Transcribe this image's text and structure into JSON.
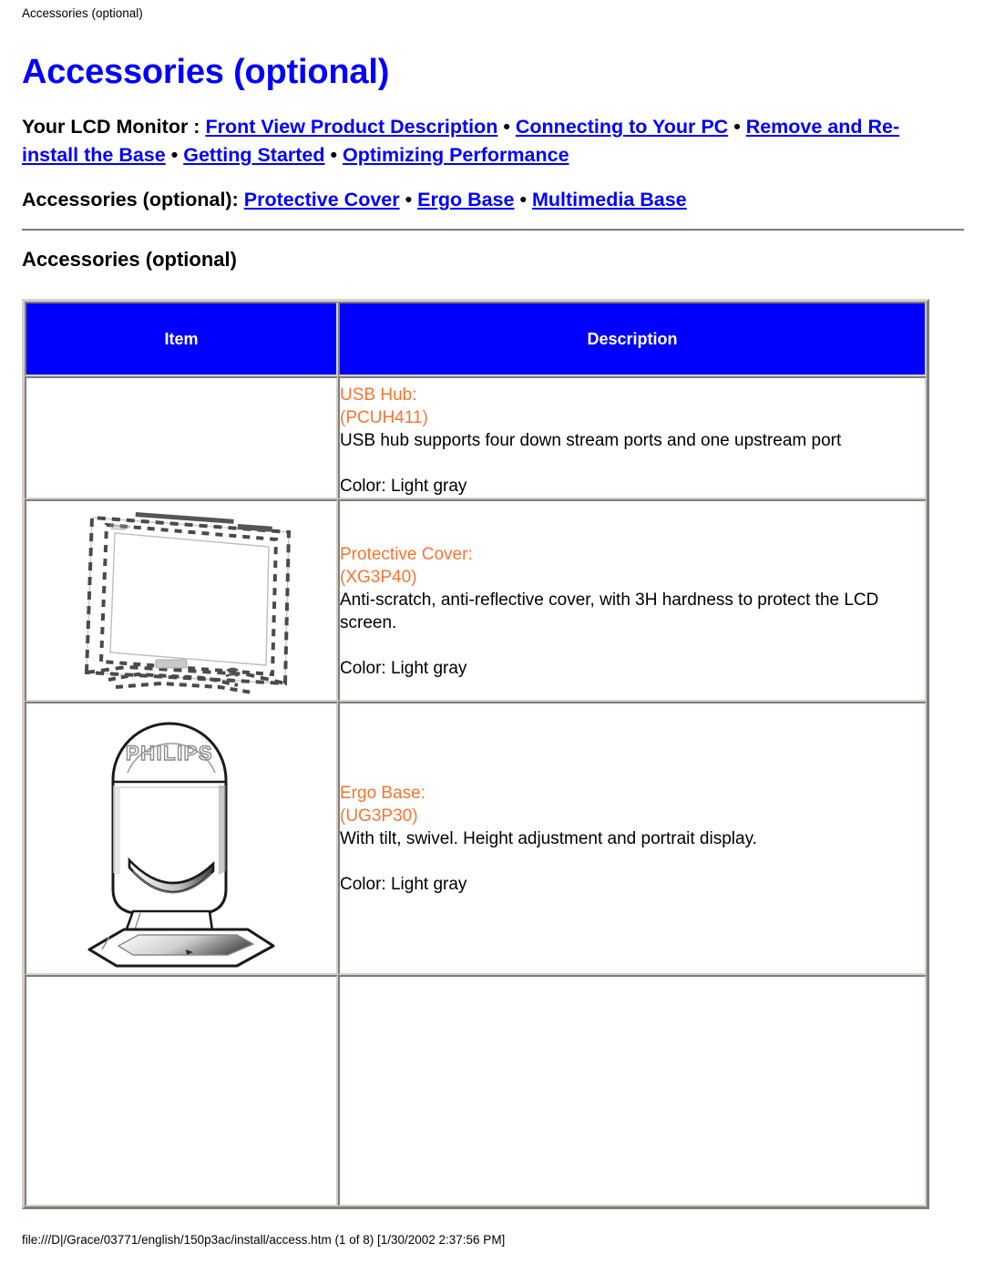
{
  "page_header": "Accessories (optional)",
  "title": "Accessories (optional)",
  "nav": {
    "line1_lead": "Your LCD Monitor",
    "line1_colon": " : ",
    "line1_links": [
      "Front View Product Description",
      "Connecting to Your PC",
      "Remove and Re-install the Base",
      "Getting Started",
      "Optimizing Performance"
    ],
    "line2_lead": "Accessories (optional):",
    "line2_links": [
      "Protective Cover",
      "Ergo Base",
      "Multimedia Base"
    ],
    "separator": "•"
  },
  "section_title": "Accessories (optional)",
  "table": {
    "headers": [
      "Item",
      "Description"
    ],
    "rows": [
      {
        "item_art": "none",
        "name": "USB Hub:",
        "code": "(PCUH411)",
        "description": "USB hub supports four down stream ports and one upstream port",
        "color": "Color: Light gray"
      },
      {
        "item_art": "lcd-monitor-dashed-outline",
        "name": "Protective Cover:",
        "code": "(XG3P40)",
        "description": "Anti-scratch, anti-reflective cover, with 3H hardness to protect the LCD screen.",
        "color": "Color: Light gray"
      },
      {
        "item_art": "philips-ergo-base-stand",
        "name": "Ergo Base:",
        "code": "(UG3P30)",
        "description": "With tilt, swivel. Height adjustment and portrait display.",
        "color": "Color: Light gray"
      },
      {
        "item_art": "none",
        "name": "",
        "code": "",
        "description": "",
        "color": ""
      }
    ]
  },
  "artwork_labels": {
    "ergo_brand": "PHILIPS"
  },
  "footer": "file:///D|/Grace/03771/english/150p3ac/install/access.htm (1 of 8) [1/30/2002 2:37:56 PM]",
  "colors": {
    "link": "#0000ff",
    "title": "#0000ff",
    "header_bg": "#0000ff",
    "header_text": "#ffffff",
    "product_accent": "#f87431",
    "body_text": "#000000"
  }
}
